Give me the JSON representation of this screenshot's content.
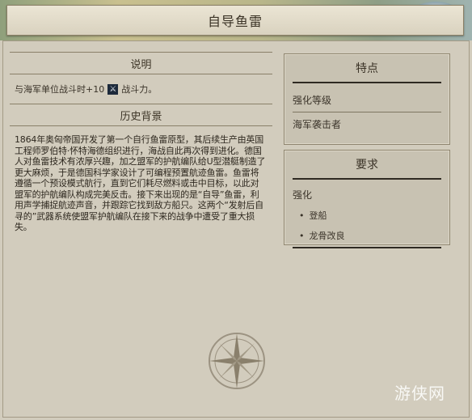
{
  "header": {
    "title": "自导鱼雷"
  },
  "description": {
    "heading": "说明",
    "bonus_prefix": "与海军单位战斗时+10",
    "bonus_suffix": "战斗力。",
    "icon": "strength-sword-icon"
  },
  "history": {
    "heading": "历史背景",
    "text": "1864年奥匈帝国开发了第一个自行鱼雷原型，其后续生产由英国工程师罗伯特·怀特海德组织进行，海战自此再次得到进化。德国人对鱼雷技术有浓厚兴趣，加之盟军的护航编队给U型潜艇制造了更大麻烦，于是德国科学家设计了可编程预置航迹鱼雷。鱼雷将遵循一个预设模式航行，直到它们耗尽燃料或击中目标，以此对盟军的护航编队构成完美反击。接下来出现的是“自导”鱼雷，利用声学捕捉航迹声音，并跟踪它找到敌方船只。这两个“发射后自寻的”武器系统使盟军护航编队在接下来的战争中遭受了重大损失。"
  },
  "features": {
    "heading": "特点",
    "label": "强化等级",
    "value": "海军袭击者"
  },
  "requirements": {
    "heading": "要求",
    "label": "强化",
    "items": [
      "登船",
      "龙骨改良"
    ]
  },
  "watermark": "游侠网",
  "colors": {
    "background": "#d2ccbd",
    "accent": "#2f2a22"
  }
}
